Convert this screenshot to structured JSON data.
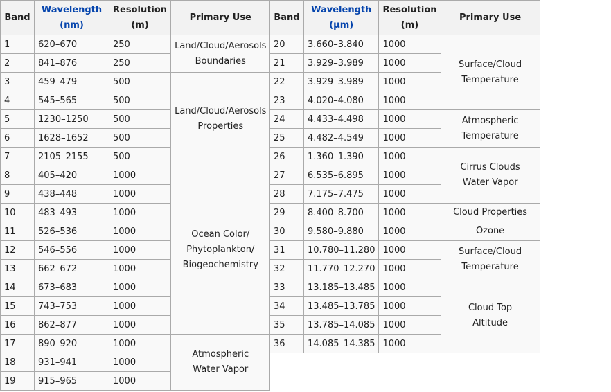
{
  "headers": {
    "band": "Band",
    "wavelength": "Wavelength",
    "unit_nm": "(nm)",
    "unit_um": "(µm)",
    "resolution": "Resolution",
    "unit_m": "(m)",
    "use": "Primary Use"
  },
  "left_rows": [
    {
      "band": "1",
      "wl": "620–670",
      "res": "250"
    },
    {
      "band": "2",
      "wl": "841–876",
      "res": "250"
    },
    {
      "band": "3",
      "wl": "459–479",
      "res": "500"
    },
    {
      "band": "4",
      "wl": "545–565",
      "res": "500"
    },
    {
      "band": "5",
      "wl": "1230–1250",
      "res": "500"
    },
    {
      "band": "6",
      "wl": "1628–1652",
      "res": "500"
    },
    {
      "band": "7",
      "wl": "2105–2155",
      "res": "500"
    },
    {
      "band": "8",
      "wl": "405–420",
      "res": "1000"
    },
    {
      "band": "9",
      "wl": "438–448",
      "res": "1000"
    },
    {
      "band": "10",
      "wl": "483–493",
      "res": "1000"
    },
    {
      "band": "11",
      "wl": "526–536",
      "res": "1000"
    },
    {
      "band": "12",
      "wl": "546–556",
      "res": "1000"
    },
    {
      "band": "13",
      "wl": "662–672",
      "res": "1000"
    },
    {
      "band": "14",
      "wl": "673–683",
      "res": "1000"
    },
    {
      "band": "15",
      "wl": "743–753",
      "res": "1000"
    },
    {
      "band": "16",
      "wl": "862–877",
      "res": "1000"
    },
    {
      "band": "17",
      "wl": "890–920",
      "res": "1000"
    },
    {
      "band": "18",
      "wl": "931–941",
      "res": "1000"
    },
    {
      "band": "19",
      "wl": "915–965",
      "res": "1000"
    }
  ],
  "left_uses": [
    {
      "row": 0,
      "span": 2,
      "lines": [
        "Land/Cloud/Aerosols",
        "Boundaries"
      ]
    },
    {
      "row": 2,
      "span": 5,
      "lines": [
        "Land/Cloud/Aerosols",
        "Properties"
      ]
    },
    {
      "row": 7,
      "span": 9,
      "lines": [
        "Ocean Color/",
        "Phytoplankton/",
        "Biogeochemistry"
      ]
    },
    {
      "row": 16,
      "span": 3,
      "lines": [
        "Atmospheric",
        "Water Vapor"
      ]
    }
  ],
  "right_rows": [
    {
      "band": "20",
      "wl": "3.660–3.840",
      "res": "1000"
    },
    {
      "band": "21",
      "wl": "3.929–3.989",
      "res": "1000"
    },
    {
      "band": "22",
      "wl": "3.929–3.989",
      "res": "1000"
    },
    {
      "band": "23",
      "wl": "4.020–4.080",
      "res": "1000"
    },
    {
      "band": "24",
      "wl": "4.433–4.498",
      "res": "1000"
    },
    {
      "band": "25",
      "wl": "4.482–4.549",
      "res": "1000"
    },
    {
      "band": "26",
      "wl": "1.360–1.390",
      "res": "1000"
    },
    {
      "band": "27",
      "wl": "6.535–6.895",
      "res": "1000"
    },
    {
      "band": "28",
      "wl": "7.175–7.475",
      "res": "1000"
    },
    {
      "band": "29",
      "wl": "8.400–8.700",
      "res": "1000"
    },
    {
      "band": "30",
      "wl": "9.580–9.880",
      "res": "1000"
    },
    {
      "band": "31",
      "wl": "10.780–11.280",
      "res": "1000"
    },
    {
      "band": "32",
      "wl": "11.770–12.270",
      "res": "1000"
    },
    {
      "band": "33",
      "wl": "13.185–13.485",
      "res": "1000"
    },
    {
      "band": "34",
      "wl": "13.485–13.785",
      "res": "1000"
    },
    {
      "band": "35",
      "wl": "13.785–14.085",
      "res": "1000"
    },
    {
      "band": "36",
      "wl": "14.085–14.385",
      "res": "1000"
    }
  ],
  "right_uses": [
    {
      "row": 0,
      "span": 4,
      "lines": [
        "Surface/Cloud",
        "Temperature"
      ]
    },
    {
      "row": 4,
      "span": 2,
      "lines": [
        "Atmospheric",
        "Temperature"
      ]
    },
    {
      "row": 6,
      "span": 3,
      "lines": [
        "Cirrus Clouds",
        "Water Vapor"
      ]
    },
    {
      "row": 9,
      "span": 1,
      "lines": [
        "Cloud Properties"
      ]
    },
    {
      "row": 10,
      "span": 1,
      "lines": [
        "Ozone"
      ]
    },
    {
      "row": 11,
      "span": 2,
      "lines": [
        "Surface/Cloud",
        "Temperature"
      ]
    },
    {
      "row": 13,
      "span": 4,
      "lines": [
        "Cloud Top",
        "Altitude"
      ]
    }
  ],
  "colors": {
    "link": "#0645ad",
    "border": "#aaaaaa",
    "header_bg": "#f2f2f2",
    "cell_bg": "#f9f9f9"
  }
}
